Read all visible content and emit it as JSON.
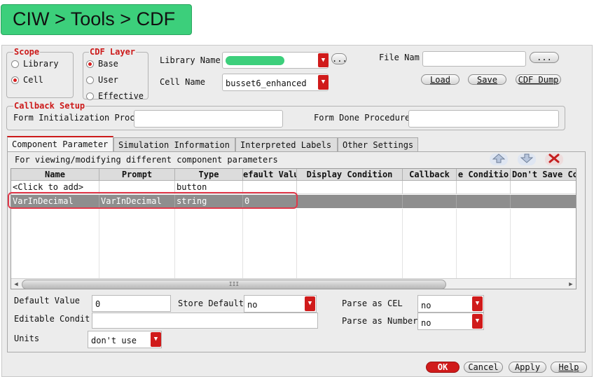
{
  "banner": {
    "title": "CIW > Tools > CDF"
  },
  "scope": {
    "title": "Scope",
    "options": [
      {
        "label": "Library",
        "selected": false
      },
      {
        "label": "Cell",
        "selected": true
      }
    ]
  },
  "cdf_layer": {
    "title": "CDF Layer",
    "options": [
      {
        "label": "Base",
        "selected": true
      },
      {
        "label": "User",
        "selected": false
      },
      {
        "label": "Effective",
        "selected": false
      }
    ]
  },
  "library_name": {
    "label": "Library Name",
    "value": ""
  },
  "cell_name": {
    "label": "Cell Name",
    "value": "busset6_enhanced"
  },
  "browse_label": "...",
  "file_name": {
    "label": "File Nam",
    "value": "",
    "browse_label": "..."
  },
  "file_buttons": {
    "load": "Load",
    "save": "Save",
    "dump": "CDF Dump"
  },
  "callback_setup": {
    "title": "Callback Setup",
    "init_label": "Form Initialization Proc",
    "init_value": "",
    "done_label": "Form Done Procedure",
    "done_value": ""
  },
  "tabs": [
    {
      "label": "Component Parameter",
      "active": true
    },
    {
      "label": "Simulation Information",
      "active": false
    },
    {
      "label": "Interpreted Labels",
      "active": false
    },
    {
      "label": "Other Settings",
      "active": false
    }
  ],
  "panel_hint": "For viewing/modifying different component parameters",
  "table": {
    "columns": [
      "Name",
      "Prompt",
      "Type",
      "efault Valu",
      "Display Condition",
      "Callback",
      "e Conditio",
      "Don't Save Co"
    ],
    "rows": [
      [
        "<Click to add>",
        "",
        "button",
        "",
        "",
        "",
        "",
        ""
      ],
      [
        "VarInDecimal",
        "VarInDecimal",
        "string",
        "0",
        "",
        "",
        "",
        ""
      ]
    ],
    "selected_row": 1
  },
  "scroll_glyph": "III",
  "param_form": {
    "default_value_label": "Default Value",
    "default_value": "0",
    "store_default_label": "Store Default",
    "store_default_value": "no",
    "parse_cel_label": "Parse as CEL",
    "parse_cel_value": "no",
    "editable_label": "Editable Condit",
    "editable_value": "",
    "parse_number_label": "Parse as Number",
    "parse_number_value": "no",
    "units_label": "Units",
    "units_value": "don't use"
  },
  "dialog_buttons": {
    "ok": "OK",
    "cancel": "Cancel",
    "apply": "Apply",
    "help": "Help"
  },
  "colors": {
    "accent_red": "#d01b1b",
    "banner_green": "#3ccf7b",
    "highlight": "#e0394a",
    "selected_row": "#8e8e8e"
  }
}
